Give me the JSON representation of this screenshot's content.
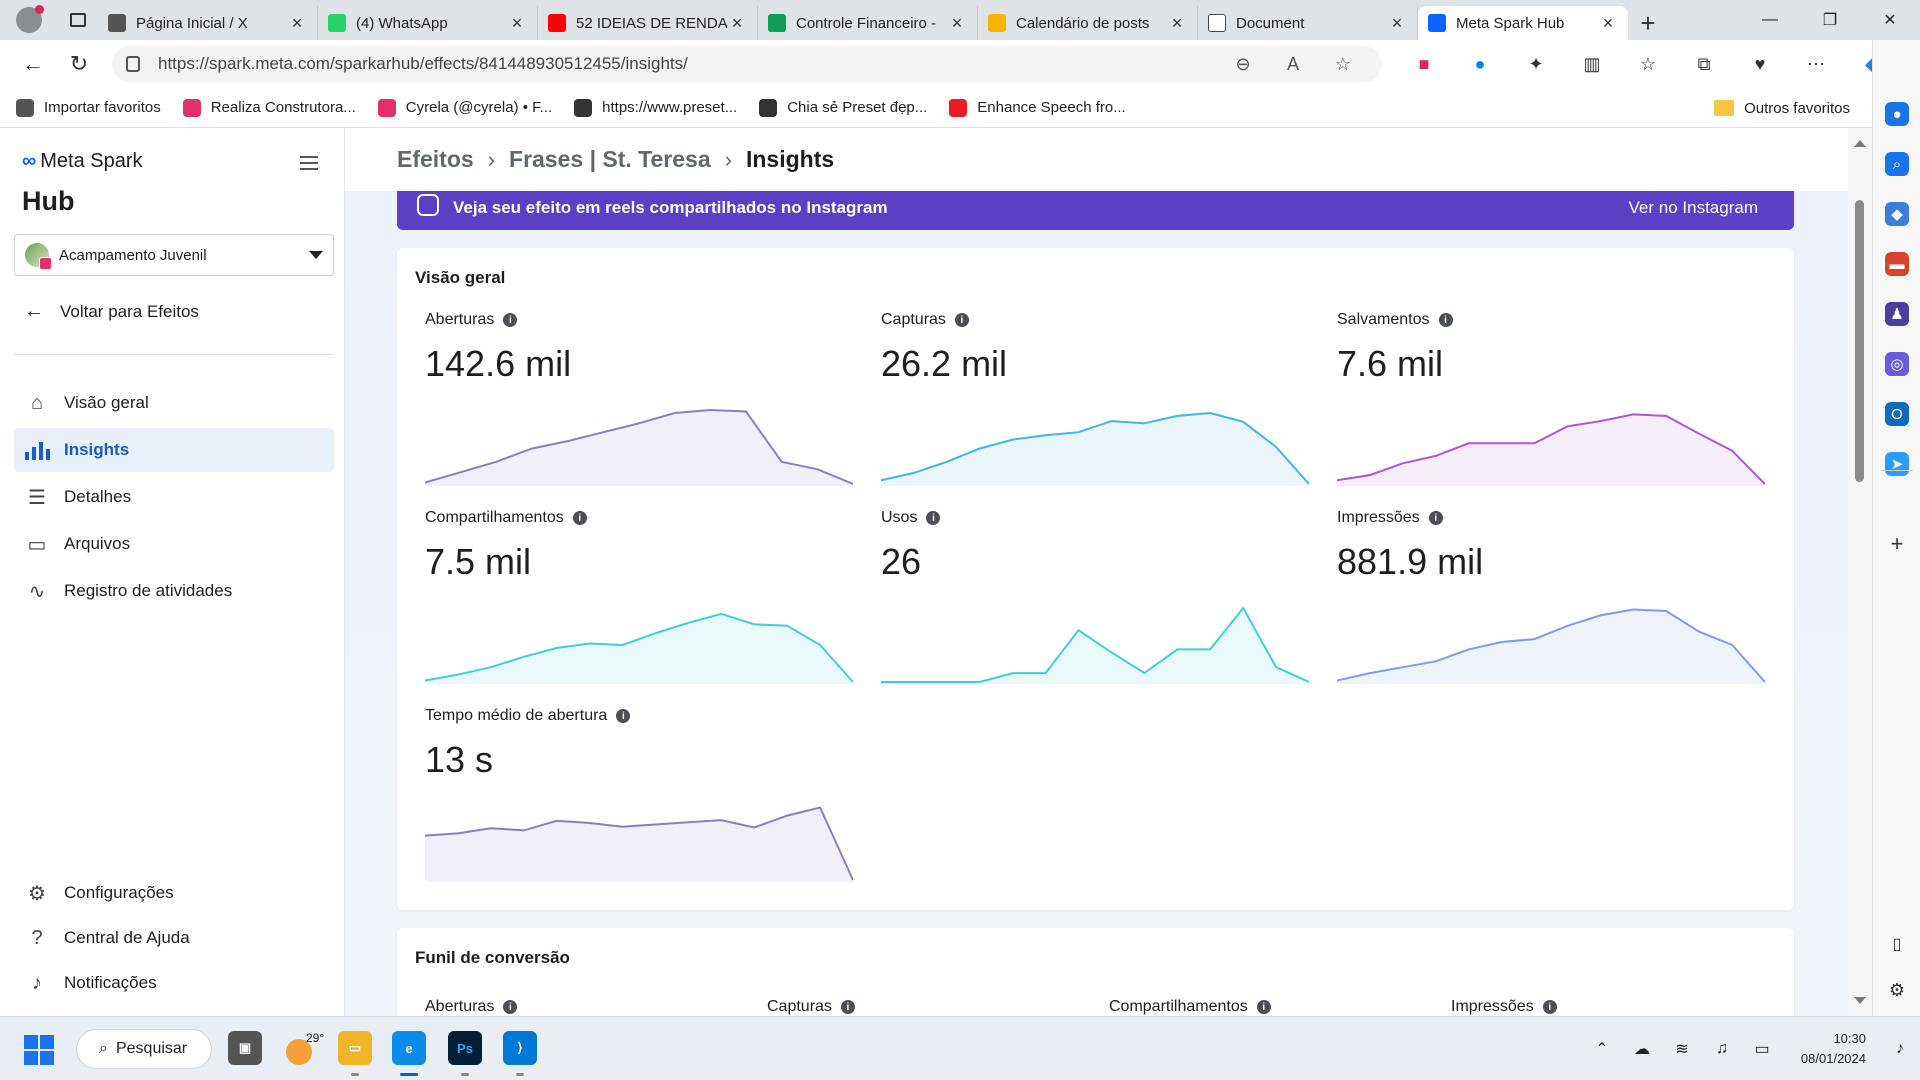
{
  "browser": {
    "tabs": [
      {
        "title": "Página Inicial / X",
        "icon": "x-logo-icon",
        "color": "#555555"
      },
      {
        "title": "(4) WhatsApp",
        "icon": "whatsapp-icon",
        "color": "#25d366"
      },
      {
        "title": "52 IDEIAS DE RENDA",
        "icon": "youtube-icon",
        "color": "#ff0000"
      },
      {
        "title": "Controle Financeiro -",
        "icon": "sheets-icon",
        "color": "#0f9d58"
      },
      {
        "title": "Calendário de posts",
        "icon": "slides-icon",
        "color": "#f4b400"
      },
      {
        "title": "Document",
        "icon": "document-icon",
        "color": "#ffffff"
      },
      {
        "title": "Meta Spark Hub",
        "icon": "meta-icon",
        "color": "#0866ff"
      }
    ],
    "address": "https://spark.meta.com/sparkarhub/effects/841448930512455/insights/",
    "favorites": [
      {
        "label": "Importar favoritos",
        "color": "#555555"
      },
      {
        "label": "Realiza Construtora...",
        "color": "#e1306c"
      },
      {
        "label": "Cyrela (@cyrela) • F...",
        "color": "#e1306c"
      },
      {
        "label": "https://www.preset...",
        "color": "#333333"
      },
      {
        "label": "Chia sẻ Preset đẹp...",
        "color": "#333333"
      },
      {
        "label": "Enhance Speech fro...",
        "color": "#ec1c24"
      }
    ],
    "other_favorites": "Outros favoritos"
  },
  "sidebar": {
    "brand": "Meta Spark",
    "hub": "Hub",
    "account": "Acampamento Juvenil",
    "back": "Voltar para Efeitos",
    "nav": [
      {
        "label": "Visão geral",
        "icon": "home-icon"
      },
      {
        "label": "Insights",
        "icon": "bar-chart-icon",
        "active": true
      },
      {
        "label": "Detalhes",
        "icon": "list-icon"
      },
      {
        "label": "Arquivos",
        "icon": "folder-icon"
      },
      {
        "label": "Registro de atividades",
        "icon": "activity-icon"
      }
    ],
    "footer": [
      {
        "label": "Configurações",
        "icon": "gear-icon"
      },
      {
        "label": "Central de Ajuda",
        "icon": "help-icon"
      },
      {
        "label": "Notificações",
        "icon": "bell-icon"
      }
    ]
  },
  "breadcrumb": [
    "Efeitos",
    "Frases | St. Teresa",
    "Insights"
  ],
  "banner": {
    "text": "Veja seu efeito em reels compartilhados no Instagram",
    "link": "Ver no Instagram"
  },
  "overview": {
    "title": "Visão geral",
    "metrics": [
      {
        "label": "Aberturas",
        "value": "142.6 mil",
        "color": "#8e7cc3",
        "fill": "#f2effa",
        "spark": [
          2,
          16,
          30,
          48,
          58,
          70,
          82,
          96,
          100,
          98,
          30,
          20,
          0
        ]
      },
      {
        "label": "Capturas",
        "value": "26.2 mil",
        "color": "#3db7e4",
        "fill": "#eaf6fc",
        "spark": [
          5,
          15,
          30,
          48,
          60,
          66,
          70,
          85,
          82,
          92,
          96,
          84,
          50,
          0
        ]
      },
      {
        "label": "Salvamentos",
        "value": "7.6 mil",
        "color": "#b054d8",
        "fill": "#f7eefb",
        "spark": [
          5,
          12,
          28,
          38,
          55,
          55,
          55,
          78,
          85,
          94,
          92,
          68,
          45,
          0
        ]
      },
      {
        "label": "Compartilhamentos",
        "value": "7.5 mil",
        "color": "#3ecfd8",
        "fill": "#eafafb",
        "spark": [
          2,
          10,
          20,
          34,
          46,
          52,
          50,
          66,
          80,
          92,
          78,
          76,
          50,
          0
        ]
      },
      {
        "label": "Usos",
        "value": "26",
        "color": "#3ecfd8",
        "fill": "#eafafb",
        "spark": [
          0,
          0,
          0,
          0,
          12,
          12,
          70,
          40,
          12,
          44,
          44,
          100,
          20,
          0
        ]
      },
      {
        "label": "Impressões",
        "value": "881.9 mil",
        "color": "#7a9ee8",
        "fill": "#eef3fc",
        "spark": [
          2,
          12,
          20,
          28,
          44,
          54,
          58,
          76,
          90,
          98,
          96,
          68,
          50,
          0
        ]
      },
      {
        "label": "Tempo médio de abertura",
        "value": "13 s",
        "color": "#8e7cc3",
        "fill": "#f2effa",
        "spark": [
          60,
          63,
          70,
          67,
          80,
          77,
          72,
          75,
          78,
          81,
          71,
          87,
          98,
          0
        ]
      }
    ]
  },
  "funnel": {
    "title": "Funil de conversão",
    "labels": [
      "Aberturas",
      "Capturas",
      "Compartilhamentos",
      "Impressões"
    ]
  },
  "taskbar": {
    "search": "Pesquisar",
    "temperature": "29°",
    "time": "10:30",
    "date": "08/01/2024"
  }
}
